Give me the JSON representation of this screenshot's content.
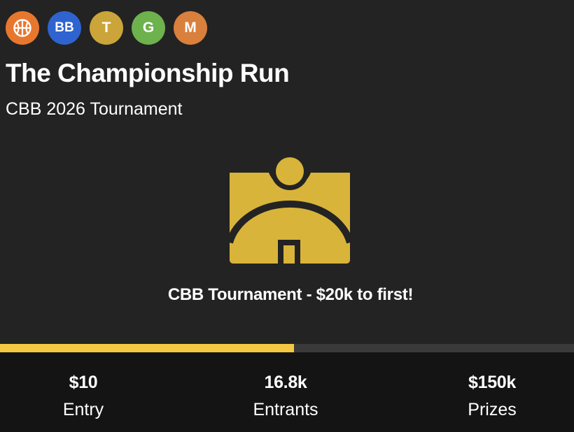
{
  "badges": [
    {
      "icon": "basketball-icon",
      "label": "",
      "color": "#e8772e"
    },
    {
      "label": "BB",
      "color": "#2f63cf"
    },
    {
      "label": "T",
      "color": "#cba53a"
    },
    {
      "label": "G",
      "color": "#6db24d"
    },
    {
      "label": "M",
      "color": "#d9803c"
    }
  ],
  "header": {
    "title": "The Championship Run",
    "subtitle": "CBB 2026 Tournament"
  },
  "hero": {
    "icon": "contest-logo-icon",
    "accent": "#d9b43a",
    "caption": "CBB Tournament - $20k to first!"
  },
  "progress": {
    "fraction": 0.512,
    "fill_color": "#f5c842"
  },
  "stats": {
    "entry": {
      "value": "$10",
      "label": "Entry"
    },
    "entrants": {
      "value": "16.8k",
      "label": "Entrants"
    },
    "prizes": {
      "value": "$150k",
      "label": "Prizes"
    }
  }
}
